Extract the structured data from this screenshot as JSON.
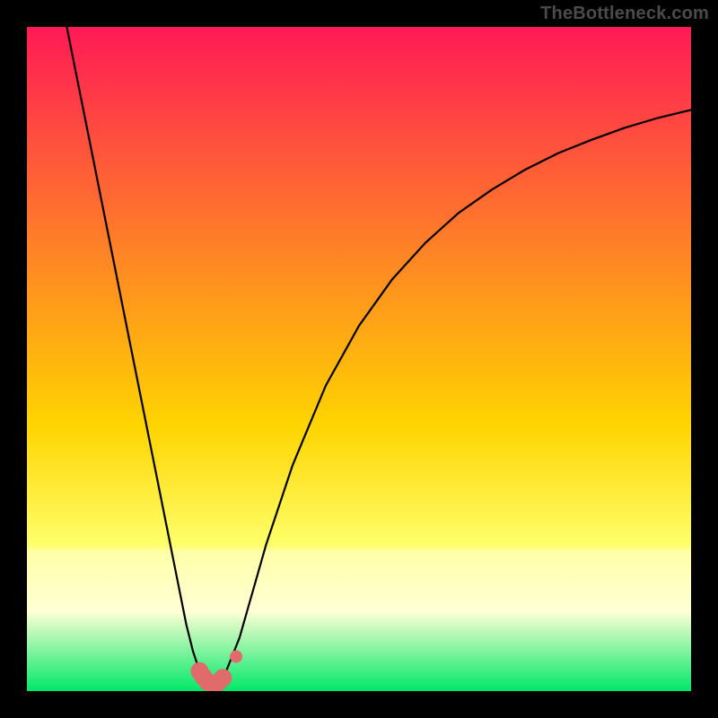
{
  "watermark": "TheBottleneck.com",
  "colors": {
    "frame": "#000000",
    "grad_top": "#ff1a56",
    "grad_60": "#ffd400",
    "grad_78": "#ffff6a",
    "grad_band_top": "#ffffa8",
    "grad_band_bot": "#ffffd6",
    "grad_bottom": "#00e868",
    "curve": "#000000",
    "marker": "#e16a6a"
  },
  "chart_data": {
    "type": "line",
    "title": "",
    "xlabel": "",
    "ylabel": "",
    "xlim": [
      0,
      100
    ],
    "ylim": [
      0,
      100
    ],
    "series": [
      {
        "name": "left-curve",
        "x": [
          6,
          8,
          10,
          12,
          14,
          16,
          18,
          20,
          22,
          23,
          24,
          25,
          26,
          27,
          28
        ],
        "values": [
          100,
          90,
          80,
          70,
          60,
          50,
          40,
          30,
          20,
          15,
          10,
          6,
          3,
          1.5,
          0.8
        ]
      },
      {
        "name": "right-curve",
        "x": [
          28,
          29,
          30,
          32,
          34,
          36,
          40,
          45,
          50,
          55,
          60,
          65,
          70,
          75,
          80,
          85,
          90,
          95,
          100
        ],
        "values": [
          0.8,
          1.5,
          3,
          8,
          15,
          22,
          34,
          46,
          55,
          62,
          67.5,
          72,
          75.5,
          78.5,
          81,
          83,
          84.8,
          86.3,
          87.5
        ]
      }
    ],
    "annotations": {
      "min_x": 28,
      "min_y": 0.8,
      "marker": {
        "shape": "L",
        "points": [
          {
            "x": 26.0,
            "y": 3.0
          },
          {
            "x": 26.5,
            "y": 2.2
          },
          {
            "x": 27.2,
            "y": 1.4
          },
          {
            "x": 28.0,
            "y": 1.0
          },
          {
            "x": 28.8,
            "y": 1.3
          },
          {
            "x": 29.5,
            "y": 2.0
          },
          {
            "x": 31.5,
            "y": 5.2
          }
        ]
      }
    }
  }
}
